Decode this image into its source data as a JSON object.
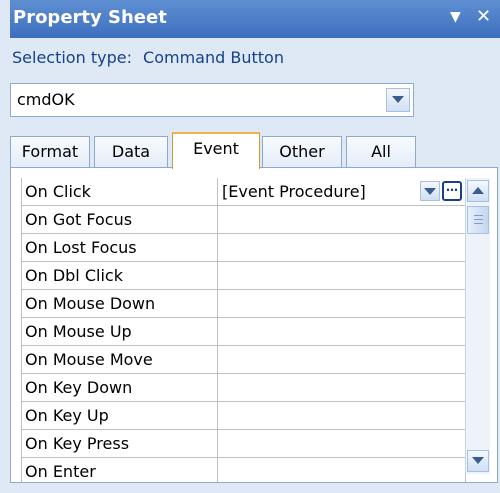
{
  "window": {
    "title": "Property Sheet",
    "dropdown_icon": "dropdown-arrow-icon",
    "close_icon": "close-icon"
  },
  "selection": {
    "label": "Selection type:",
    "type": "Command Button"
  },
  "combo": {
    "value": "cmdOK"
  },
  "tabs": [
    {
      "label": "Format"
    },
    {
      "label": "Data"
    },
    {
      "label": "Event",
      "active": true
    },
    {
      "label": "Other"
    },
    {
      "label": "All"
    }
  ],
  "properties": [
    {
      "label": "On Click",
      "value": "[Event Procedure]"
    },
    {
      "label": "On Got Focus",
      "value": ""
    },
    {
      "label": "On Lost Focus",
      "value": ""
    },
    {
      "label": "On Dbl Click",
      "value": ""
    },
    {
      "label": "On Mouse Down",
      "value": ""
    },
    {
      "label": "On Mouse Up",
      "value": ""
    },
    {
      "label": "On Mouse Move",
      "value": ""
    },
    {
      "label": "On Key Down",
      "value": ""
    },
    {
      "label": "On Key Up",
      "value": ""
    },
    {
      "label": "On Key Press",
      "value": ""
    },
    {
      "label": "On Enter",
      "value": ""
    }
  ],
  "colors": {
    "title_bar": "#4a7cc7",
    "panel_bg": "#dfe9f5",
    "accent_text": "#15428b",
    "active_tab_border": "#f0b54a"
  }
}
